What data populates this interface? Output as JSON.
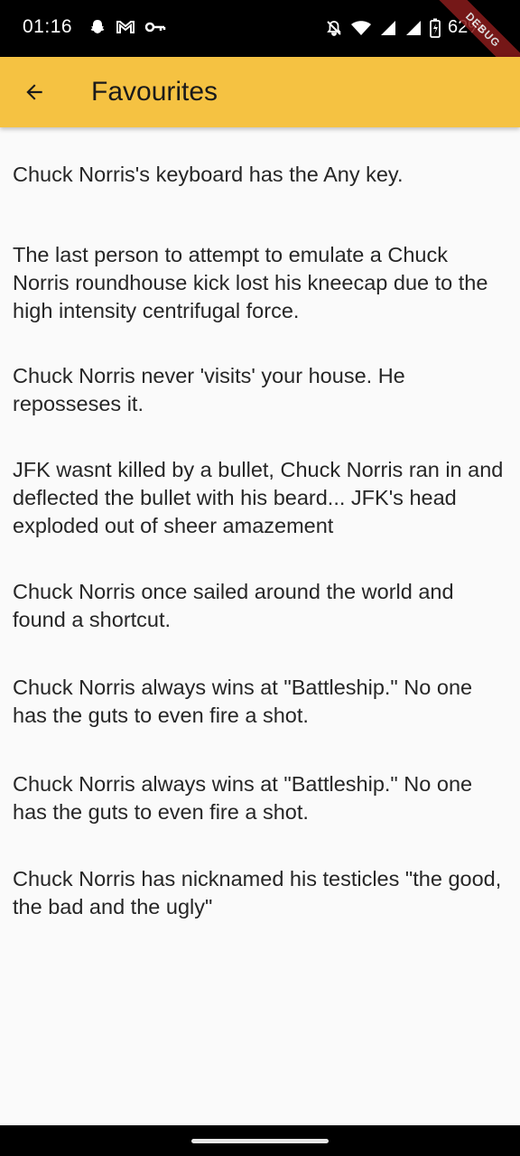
{
  "status_bar": {
    "time": "01:16",
    "battery": "62%",
    "left_icons": [
      "snapchat-icon",
      "gmail-icon",
      "vpn-key-icon"
    ],
    "right_icons": [
      "notifications-off-icon",
      "wifi-icon",
      "signal-icon",
      "signal-icon",
      "battery-icon"
    ],
    "debug_label": "DEBUG"
  },
  "app_bar": {
    "title": "Favourites",
    "background": "#f5c242",
    "back_icon": "arrow-back-icon"
  },
  "jokes": [
    "Chuck Norris's keyboard has the Any key.",
    "The last person to attempt to emulate a Chuck Norris roundhouse kick lost his kneecap due to the high intensity centrifugal force.",
    "Chuck Norris never 'visits' your house. He reposseses it.",
    "JFK wasnt killed by a bullet, Chuck Norris ran in and deflected the bullet with his beard... JFK's head exploded out of sheer amazement",
    "Chuck Norris once sailed around the world and found a shortcut.",
    "Chuck Norris always wins at \"Battleship.\" No one has the guts to even fire a shot.",
    "Chuck Norris always wins at \"Battleship.\" No one has the guts to even fire a shot.",
    "Chuck Norris has nicknamed his testicles \"the good, the bad and the ugly\""
  ]
}
